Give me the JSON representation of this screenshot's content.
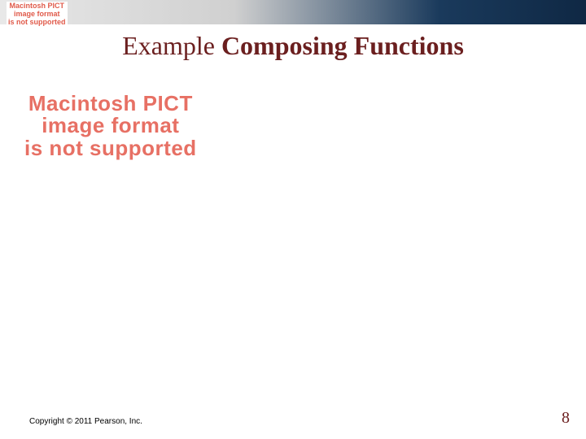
{
  "header": {
    "pict_small": {
      "line1": "Macintosh PICT",
      "line2": "image format",
      "line3": "is not supported"
    }
  },
  "title": {
    "light": "Example ",
    "bold": "Composing Functions"
  },
  "body": {
    "pict_large": {
      "line1": "Macintosh PICT",
      "line2": "image format",
      "line3": "is not supported"
    }
  },
  "footer": {
    "copyright": "Copyright © 2011 Pearson, Inc.",
    "page_number": "8"
  }
}
